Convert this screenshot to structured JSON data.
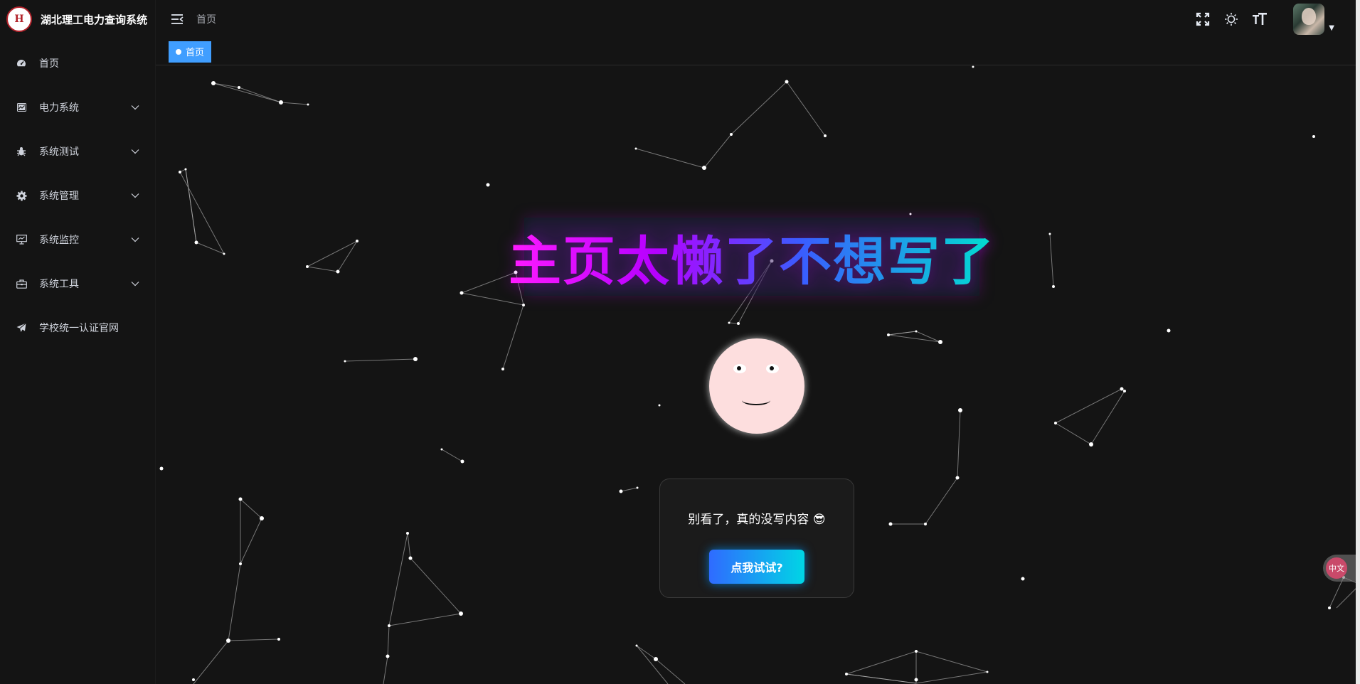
{
  "app": {
    "title": "湖北理工电力查询系统",
    "logo_text": "H"
  },
  "sidebar": {
    "items": [
      {
        "label": "首页",
        "icon": "dashboard-icon",
        "has_children": false
      },
      {
        "label": "电力系统",
        "icon": "chart-icon",
        "has_children": true
      },
      {
        "label": "系统测试",
        "icon": "bug-icon",
        "has_children": true
      },
      {
        "label": "系统管理",
        "icon": "gear-icon",
        "has_children": true
      },
      {
        "label": "系统监控",
        "icon": "monitor-icon",
        "has_children": true
      },
      {
        "label": "系统工具",
        "icon": "toolbox-icon",
        "has_children": true
      },
      {
        "label": "学校统一认证官网",
        "icon": "send-icon",
        "has_children": false
      }
    ]
  },
  "topbar": {
    "breadcrumb": "首页",
    "icons": [
      "fullscreen-icon",
      "theme-toggle-icon",
      "font-size-icon"
    ]
  },
  "tags": {
    "active": "首页"
  },
  "main": {
    "headline": "主页太懒了不想写了",
    "message": "别看了，真的没写内容 😎",
    "button_label": "点我试试?",
    "float_badge": "中文"
  },
  "colors": {
    "accent": "#409eff",
    "background": "#141414",
    "face": "#fddede",
    "button_gradient_start": "#2f6bff",
    "button_gradient_end": "#00d5e5"
  }
}
